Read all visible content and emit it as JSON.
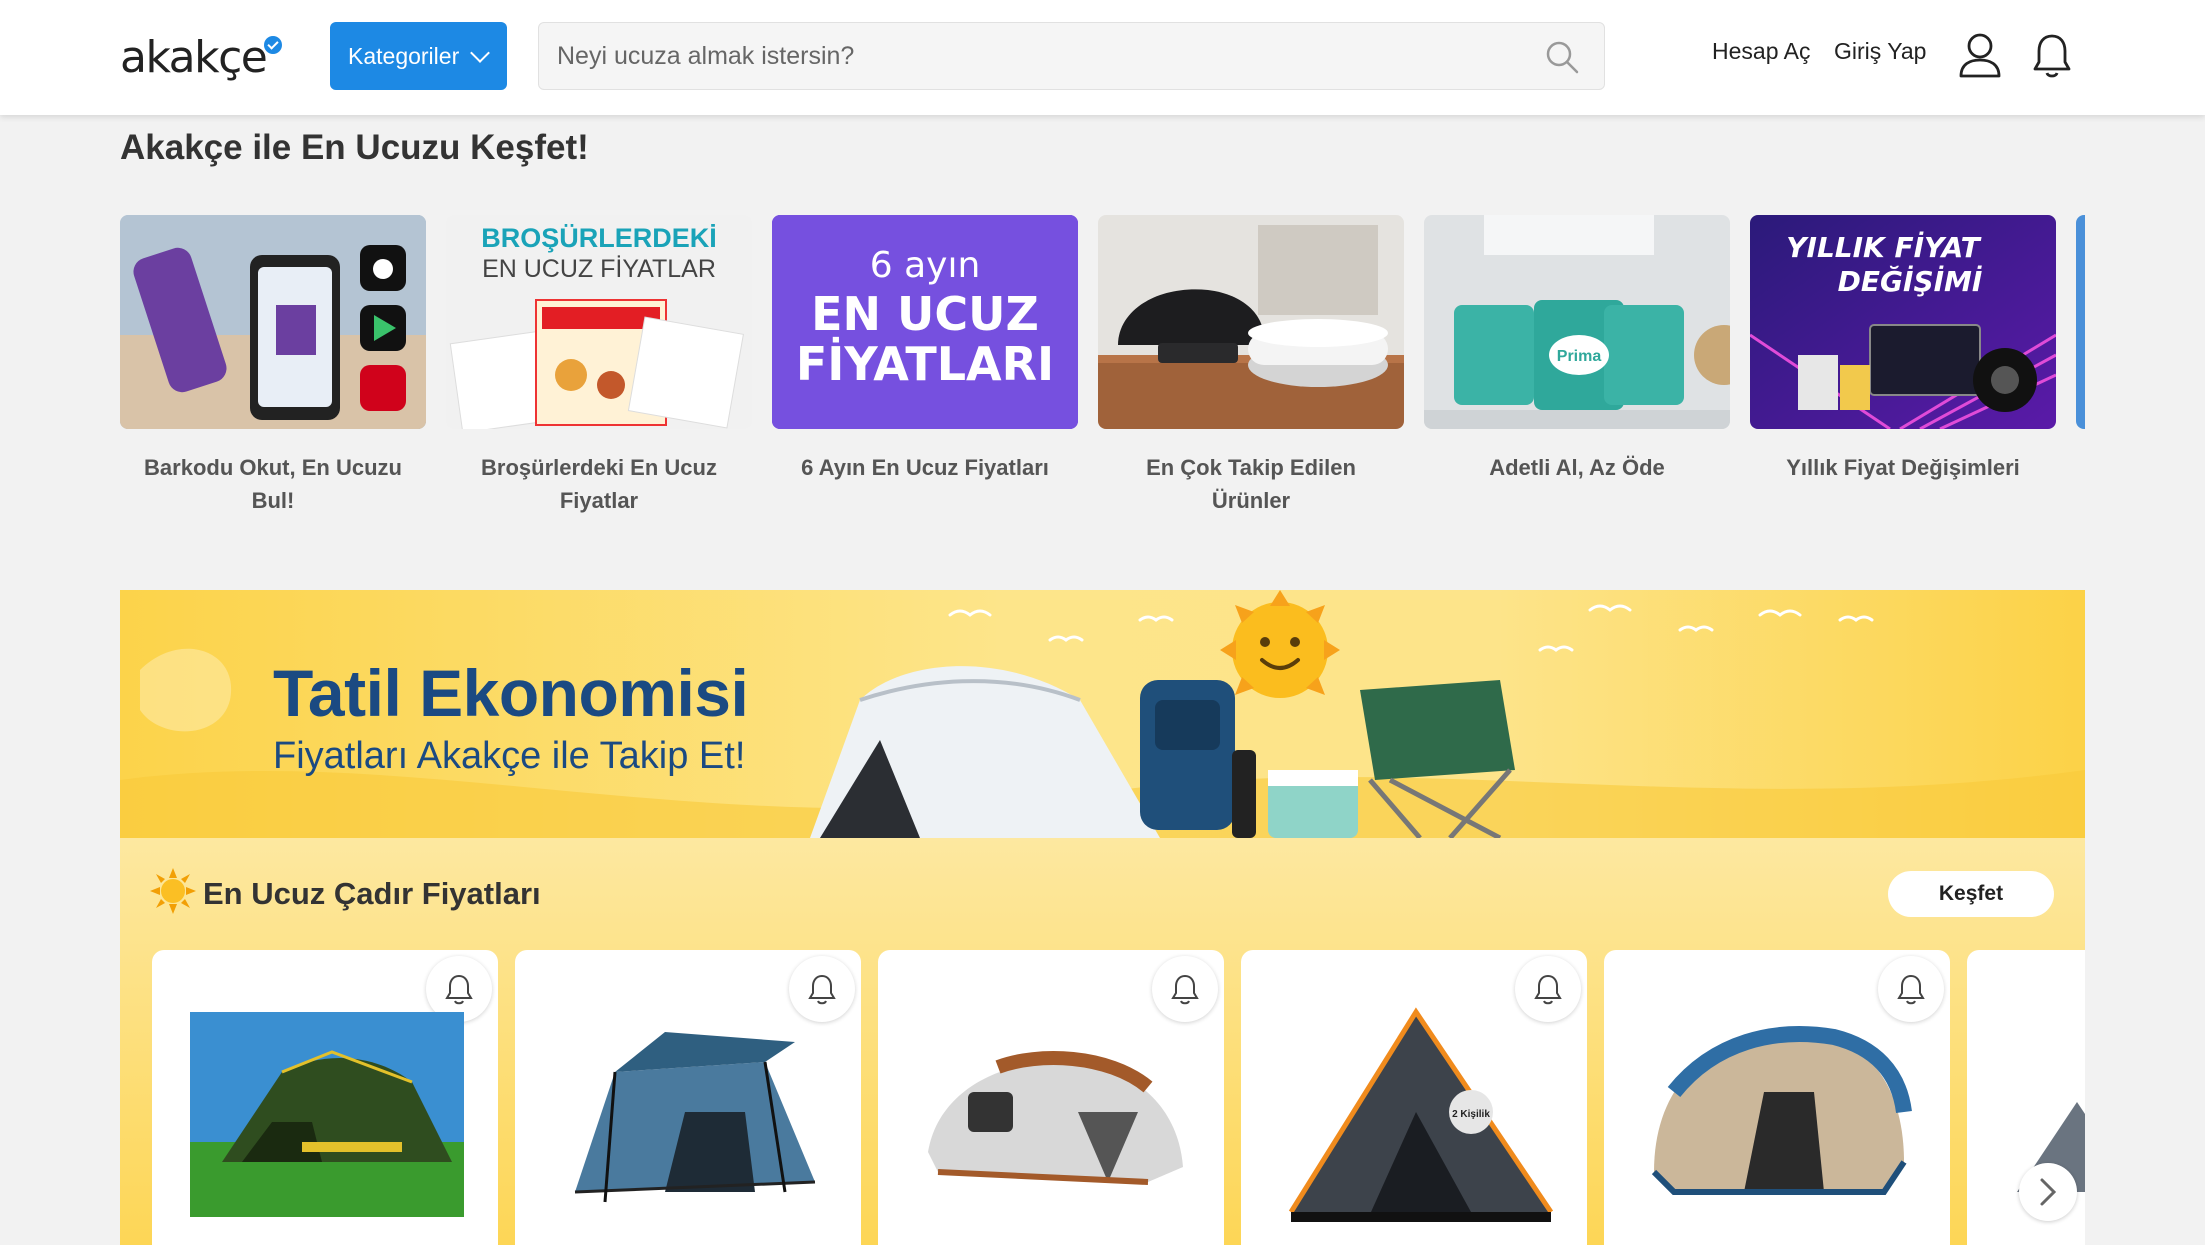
{
  "header": {
    "logo_text": "akakçe",
    "categories_label": "Kategoriler",
    "search_placeholder": "Neyi ucuza almak istersin?",
    "signup_label": "Hesap Aç",
    "login_label": "Giriş Yap"
  },
  "discover": {
    "title": "Akakçe ile En Ucuzu Keşfet!",
    "cards": [
      {
        "label": "Barkodu Okut, En Ucuzu Bul!"
      },
      {
        "label": "Broşürlerdeki En Ucuz Fiyatlar",
        "img_line1": "BROŞÜRLERDEKİ",
        "img_line2": "EN UCUZ FİYATLAR"
      },
      {
        "label": "6 Ayın En Ucuz Fiyatları",
        "img_line1": "6 ayın",
        "img_line2": "EN UCUZ",
        "img_line3": "FİYATLARI"
      },
      {
        "label": "En Çok Takip Edilen Ürünler"
      },
      {
        "label": "Adetli Al, Az Öde",
        "img_brand": "Prima"
      },
      {
        "label": "Yıllık Fiyat Değişimleri",
        "img_line1": "YILLIK FİYAT",
        "img_line2": "DEĞİŞİMİ"
      }
    ]
  },
  "banner": {
    "title": "Tatil Ekonomisi",
    "subtitle": "Fiyatları Akakçe ile Takip Et!"
  },
  "tents": {
    "title": "En Ucuz Çadır Fiyatları",
    "cta": "Keşfet",
    "badge": "2 Kişilik"
  },
  "colors": {
    "brand_blue": "#1d89e4",
    "banner_text": "#1b4a82",
    "banner_yellow": "#fcd34a"
  }
}
